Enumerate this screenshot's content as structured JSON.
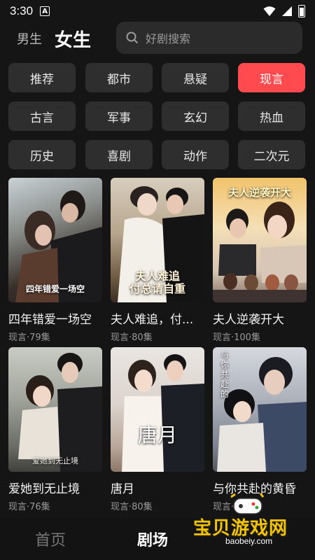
{
  "status_bar": {
    "time": "3:30",
    "a_badge": "A"
  },
  "gender_tabs": [
    "男生",
    "女生"
  ],
  "search": {
    "placeholder": "好剧搜索"
  },
  "categories": [
    "推荐",
    "都市",
    "悬疑",
    "现言",
    "古言",
    "军事",
    "玄幻",
    "热血",
    "历史",
    "喜剧",
    "动作",
    "二次元"
  ],
  "active_category": "现言",
  "dramas": [
    {
      "title": "四年错爱一场空",
      "meta": "现言·79集",
      "poster_text": "四年错爱一场空"
    },
    {
      "title": "夫人难追，付...",
      "meta": "现言·80集",
      "poster_text": "夫人难追\n付总请自重"
    },
    {
      "title": "夫人逆袭开大",
      "meta": "现言·100集",
      "poster_text": "夫人逆袭开大"
    },
    {
      "title": "爱她到无止境",
      "meta": "现言·76集",
      "poster_text": "爱她到无止境"
    },
    {
      "title": "唐月",
      "meta": "现言·80集",
      "poster_text": "唐月"
    },
    {
      "title": "与你共赴的黄昏",
      "meta": "现言·",
      "poster_text": "与你共赴的"
    }
  ],
  "bottom_nav": [
    "首页",
    "剧场"
  ],
  "watermark": {
    "title": "宝贝游戏网",
    "url": "baobeiy.com"
  },
  "colors": {
    "accent": "#ff4a4f",
    "background": "#151515",
    "chip": "#2e2e2e"
  }
}
